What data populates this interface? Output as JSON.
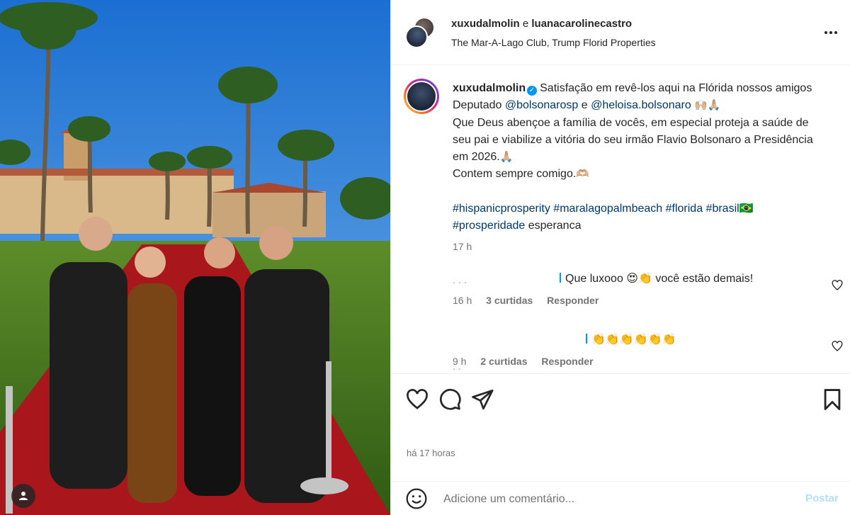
{
  "header": {
    "author1": "xuxudalmolin",
    "conjunction": "e",
    "author2": "luanacarolinecastro",
    "location": "The Mar-A-Lago Club, Trump Florid Properties"
  },
  "caption": {
    "username": "xuxudalmolin",
    "verified_glyph": "✓",
    "text1": "Satisfação em revê-los aqui na Flórida nossos amigos Deputado",
    "mention1": "@bolsonarosp",
    "conj": "e",
    "mention2": "@heloisa.bolsonaro",
    "emoji1": "🙌🏼🙏🏼",
    "text2": "Que Deus abençoe a família de vocês, em especial proteja a saúde de seu pai e viabilize a vitória do seu irmão Flavio Bolsonaro a Presidência em 2026.",
    "emoji2": "🙏🏼",
    "text3": "Contem sempre comigo.",
    "emoji3": "🫶🏼",
    "hashtags": "#hispanicprosperity #maralagopalmbeach #florida #brasil🇧🇷",
    "hashtag_last": "#prosperidade",
    "tail": "esperanca",
    "time": "17 h"
  },
  "comments": [
    {
      "text": "Que luxooo 😍👏 você estão demais!",
      "time": "16 h",
      "likes": "3 curtidas",
      "reply": "Responder"
    },
    {
      "text": "👏👏👏👏👏👏",
      "time": "9 h",
      "likes": "2 curtidas",
      "reply": "Responder"
    }
  ],
  "meta": {
    "posted": "há 17 horas"
  },
  "composer": {
    "placeholder": "Adicione um comentário...",
    "post_label": "Postar"
  },
  "colors": {
    "link": "#00376b",
    "verified": "#0095f6",
    "post_disabled": "#b2dffc",
    "muted": "#737373"
  },
  "icons": [
    "like-icon",
    "comment-icon",
    "share-icon",
    "save-icon",
    "emoji-icon",
    "user-tag-icon",
    "more-icon"
  ]
}
